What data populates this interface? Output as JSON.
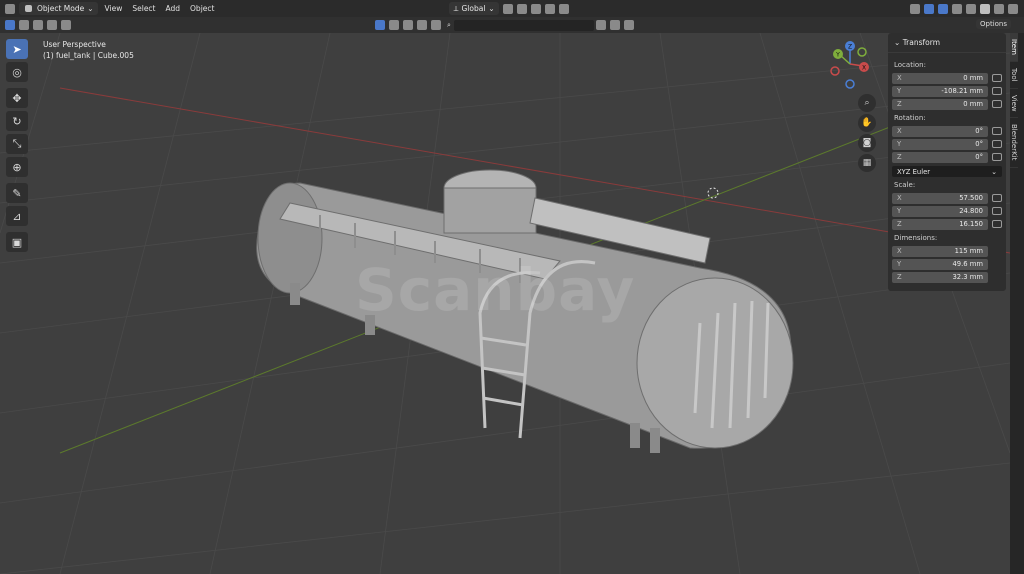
{
  "header": {
    "mode_label": "Object Mode",
    "menu": [
      "View",
      "Select",
      "Add",
      "Object"
    ],
    "orientation_label": "Global"
  },
  "options_label": "Options",
  "viewport": {
    "view_name": "User Perspective",
    "object_info": "(1) fuel_tank | Cube.005",
    "watermark": "Scanbay"
  },
  "gizmo": {
    "x": "X",
    "y": "Y",
    "z": "Z"
  },
  "npanel": {
    "title": "Transform",
    "location_label": "Location:",
    "location": [
      {
        "axis": "X",
        "value": "0 mm"
      },
      {
        "axis": "Y",
        "value": "-108.21 mm"
      },
      {
        "axis": "Z",
        "value": "0 mm"
      }
    ],
    "rotation_label": "Rotation:",
    "rotation": [
      {
        "axis": "X",
        "value": "0°"
      },
      {
        "axis": "Y",
        "value": "0°"
      },
      {
        "axis": "Z",
        "value": "0°"
      }
    ],
    "rotation_mode": "XYZ Euler",
    "scale_label": "Scale:",
    "scale": [
      {
        "axis": "X",
        "value": "57.500"
      },
      {
        "axis": "Y",
        "value": "24.800"
      },
      {
        "axis": "Z",
        "value": "16.150"
      }
    ],
    "dimensions_label": "Dimensions:",
    "dimensions": [
      {
        "axis": "X",
        "value": "115 mm"
      },
      {
        "axis": "Y",
        "value": "49.6 mm"
      },
      {
        "axis": "Z",
        "value": "32.3 mm"
      }
    ]
  },
  "sidetabs": [
    "Item",
    "Tool",
    "View",
    "BlenderKit"
  ],
  "colors": {
    "accent": "#4a72b5",
    "x_axis": "#c94b4b",
    "y_axis": "#7fae3c",
    "z_axis": "#4a7fd6"
  }
}
